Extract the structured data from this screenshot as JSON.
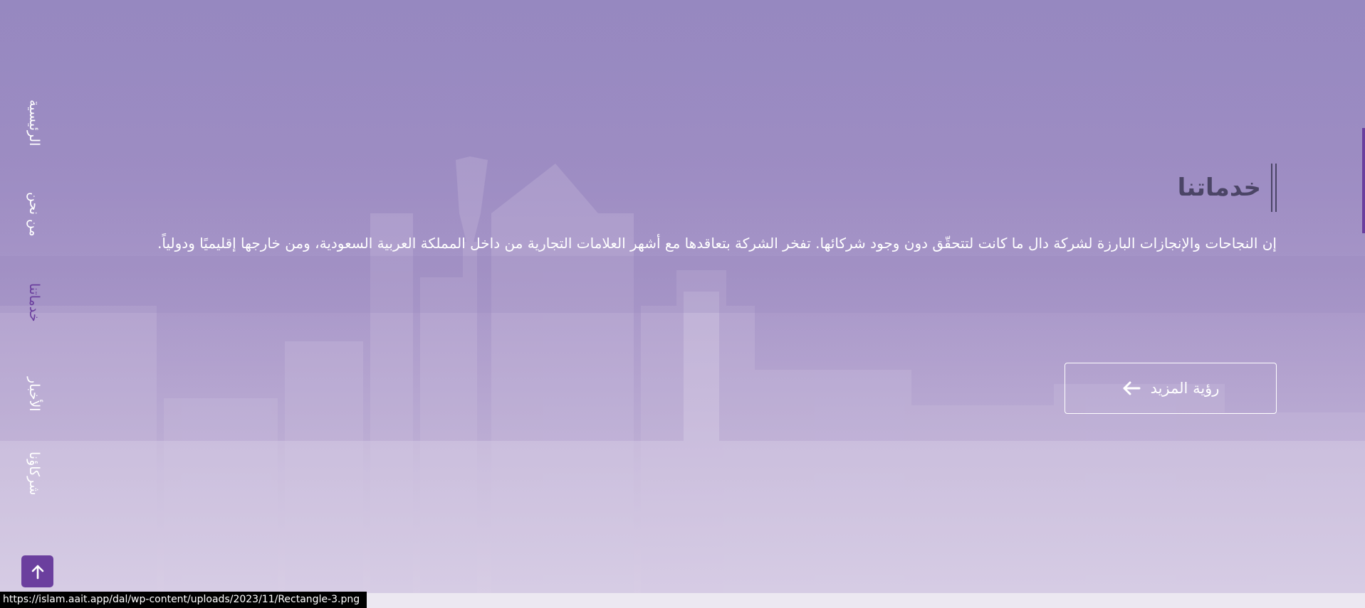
{
  "nav": {
    "items": [
      {
        "label": "الرئيسية",
        "active": false
      },
      {
        "label": "من نحن",
        "active": false
      },
      {
        "label": "خدماتنا",
        "active": true
      },
      {
        "label": "الأخبار",
        "active": false
      },
      {
        "label": "شركاؤنا",
        "active": false
      }
    ]
  },
  "section": {
    "title": "خدماتنا",
    "description": "إن النجاحات والإنجازات البارزة لشركة دال ما كانت لتتحقّق دون وجود شركائها. تفخر الشركة بتعاقدها مع أشهر العلامات التجارية من داخل المملكة العربية السعودية، ومن خارجها إقليميًا ودولياً.",
    "button_label": "رؤية المزيد"
  },
  "icons": {
    "more_button": "arrow-left-icon",
    "to_top": "arrow-up-icon"
  },
  "colors": {
    "accent": "#6b3f9e",
    "overlay": "#9688c0",
    "title": "#4b4566"
  },
  "status_bar": {
    "url": "https://islam.aait.app/dal/wp-content/uploads/2023/11/Rectangle-3.png"
  }
}
